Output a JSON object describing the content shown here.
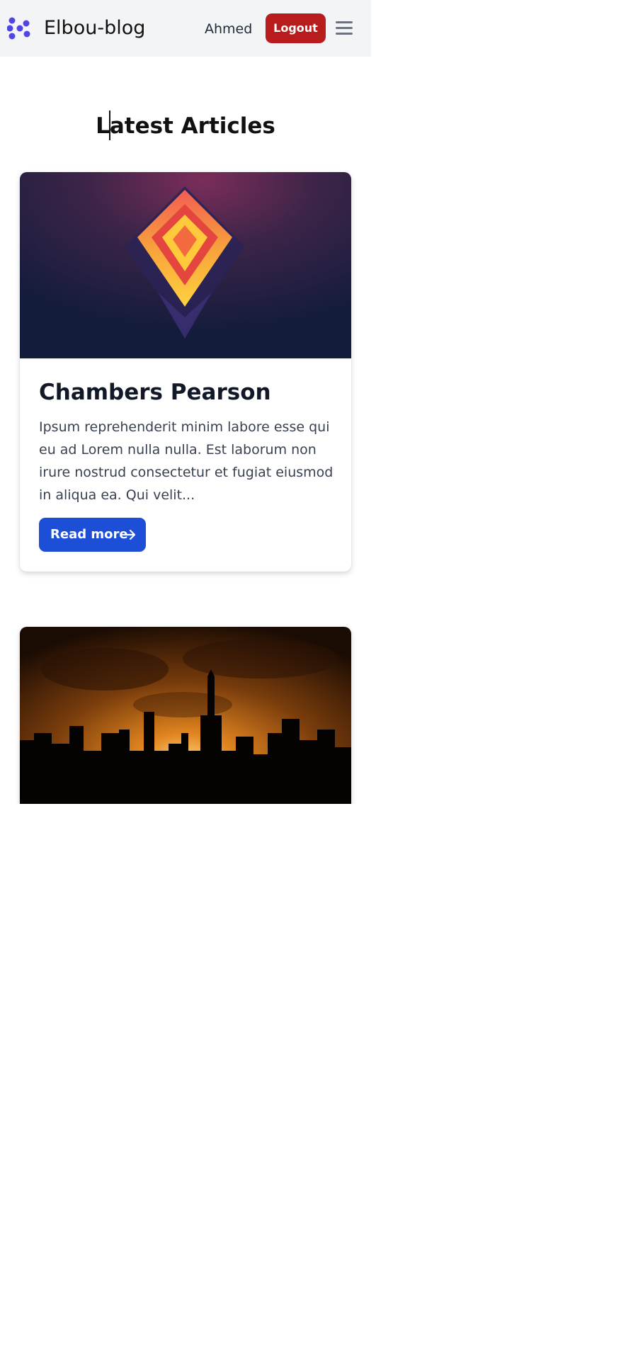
{
  "header": {
    "brand": "Elbou-blog",
    "user_name": "Ahmed",
    "logout_label": "Logout",
    "logo_icon": "logo-dots-icon",
    "menu_icon": "hamburger-menu-icon"
  },
  "main": {
    "title": "Latest Articles",
    "articles": [
      {
        "title": "Chambers Pearson",
        "excerpt": "Ipsum reprehenderit minim labore esse qui eu ad Lorem nulla nulla. Est laborum non irure nostrud consectetur et fugiat eiusmod in aliqua ea. Qui velit...",
        "read_more_label": "Read more",
        "image": "abstract-geometric-art"
      },
      {
        "image": "city-skyline-sunset"
      }
    ]
  },
  "colors": {
    "navbar_bg": "#f3f4f6",
    "logout_bg": "#b91c1c",
    "read_more_bg": "#1d4ed8",
    "logo": "#4f46e5",
    "menu_icon": "#6b7280"
  }
}
